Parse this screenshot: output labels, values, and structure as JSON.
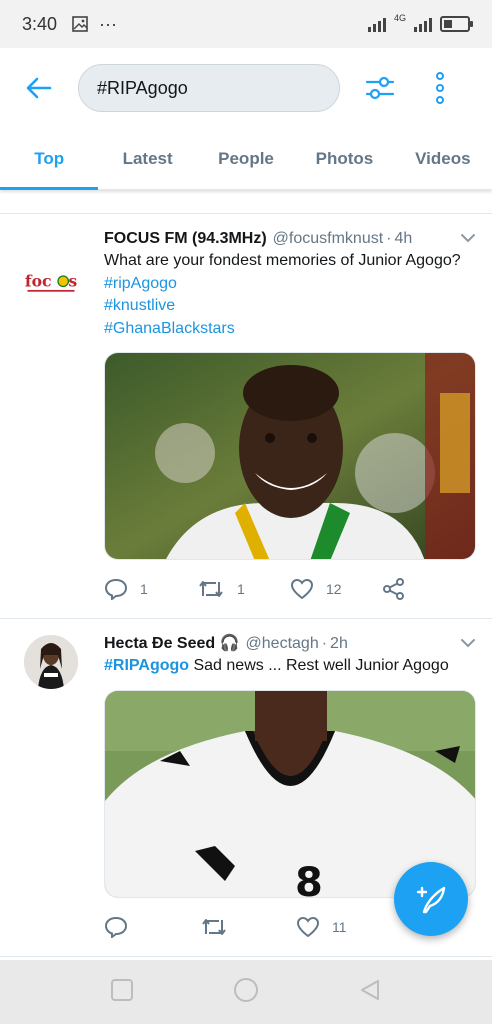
{
  "status_bar": {
    "time": "3:40",
    "network": "4G"
  },
  "header": {
    "search_query": "#RIPAgogo"
  },
  "tabs": [
    {
      "label": "Top",
      "active": true
    },
    {
      "label": "Latest",
      "active": false
    },
    {
      "label": "People",
      "active": false
    },
    {
      "label": "Photos",
      "active": false
    },
    {
      "label": "Videos",
      "active": false
    }
  ],
  "tweets": [
    {
      "name": "FOCUS FM (94.3MHz)",
      "handle": "@focusfmknust",
      "time_ago": "4h",
      "avatar_text": "focus",
      "text": "What are your fondest memories of Junior Agogo?",
      "hashtags": [
        "#ripAgogo",
        "#knustlive",
        "#GhanaBlackstars"
      ],
      "replies": "1",
      "retweets": "1",
      "likes": "12"
    },
    {
      "name": "Hecta Ɖe Seed 🎧",
      "handle": "@hectagh",
      "time_ago": "2h",
      "hashtag": "#RIPAgogo",
      "text": " Sad news ... Rest well Junior Agogo",
      "replies": "",
      "retweets": "",
      "likes": "11"
    }
  ],
  "colors": {
    "accent": "#1da1f2",
    "link": "#1b95e0",
    "muted": "#657786"
  }
}
